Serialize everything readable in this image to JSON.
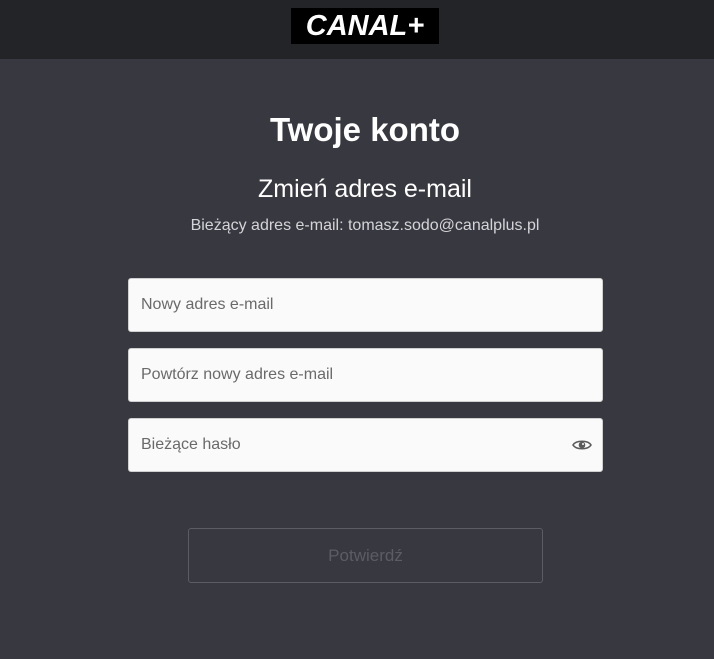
{
  "header": {
    "logo_text": "CANAL",
    "logo_plus": "+"
  },
  "main": {
    "title": "Twoje konto",
    "section_title": "Zmień adres e-mail",
    "current_email_text": "Bieżący adres e-mail: tomasz.sodo@canalplus.pl"
  },
  "form": {
    "new_email_placeholder": "Nowy adres e-mail",
    "new_email_value": "",
    "repeat_email_placeholder": "Powtórz nowy adres e-mail",
    "repeat_email_value": "",
    "password_placeholder": "Bieżące hasło",
    "password_value": "",
    "password_toggle_icon": "eye-icon",
    "confirm_label": "Potwierdź",
    "confirm_enabled": false
  },
  "colors": {
    "header_bg": "#232427",
    "page_bg": "#383840",
    "input_bg": "#fafafa",
    "button_disabled": "#5c5c64"
  }
}
